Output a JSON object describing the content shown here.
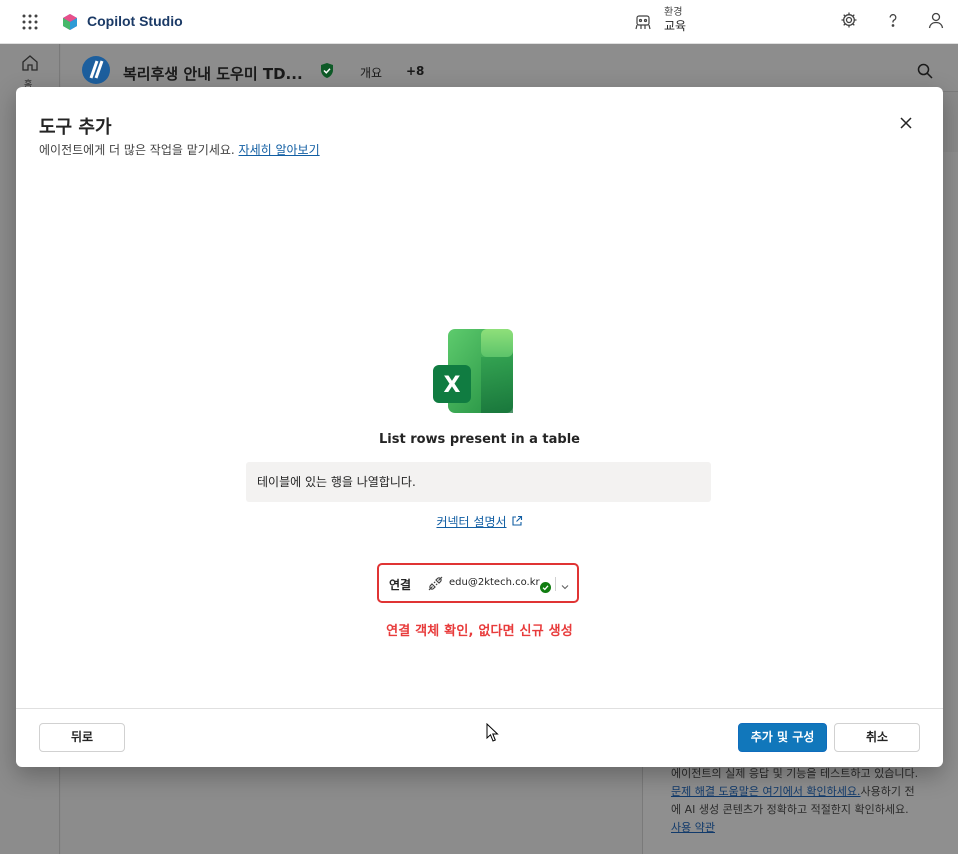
{
  "app": {
    "title": "Copilot Studio",
    "environment_label": "환경",
    "environment_name": "교육"
  },
  "left_rail": {
    "home_label": "홈"
  },
  "agent": {
    "name": "복리후생 안내 도우미 TD...",
    "tabs": [
      "개요",
      "+8"
    ]
  },
  "background_panel": {
    "text_1": "에이전트의 실제 응답 및 기능을 테스트하고 있습니다.",
    "link_1": "문제 해결 도움말은 여기에서 확인하세요.",
    "text_2": "사용하기 전에 AI 생성 콘텐츠가 정확하고 적절한지 확인하세요.",
    "link_2": "사용 약관"
  },
  "modal": {
    "title": "도구 추가",
    "subtitle": "에이전트에게 더 많은 작업을 맡기세요.",
    "learn_more": "자세히 알아보기",
    "tool_name": "List rows present in a table",
    "tool_description": "테이블에 있는 행을 나열합니다.",
    "connector_doc_link": "커넥터 설명서",
    "connection": {
      "label": "연결",
      "account": "edu@2ktech.co.kr"
    },
    "annotation": "연결 객체 확인, 없다면 신규 생성",
    "buttons": {
      "back": "뒤로",
      "add_configure": "추가 및 구성",
      "cancel": "취소"
    }
  },
  "colors": {
    "accent": "#1177bb",
    "annotation_red": "#e03434",
    "excel_green": "#107c41"
  },
  "icons": [
    "waffle-icon",
    "copilot-logo-icon",
    "environment-icon",
    "settings-icon",
    "help-icon",
    "account-icon",
    "home-icon",
    "agent-logo-icon",
    "shield-check-icon",
    "search-icon",
    "close-icon",
    "excel-logo-icon",
    "external-link-icon",
    "connection-plug-icon",
    "check-circle-icon",
    "chevron-down-icon",
    "mouse-cursor-icon"
  ]
}
